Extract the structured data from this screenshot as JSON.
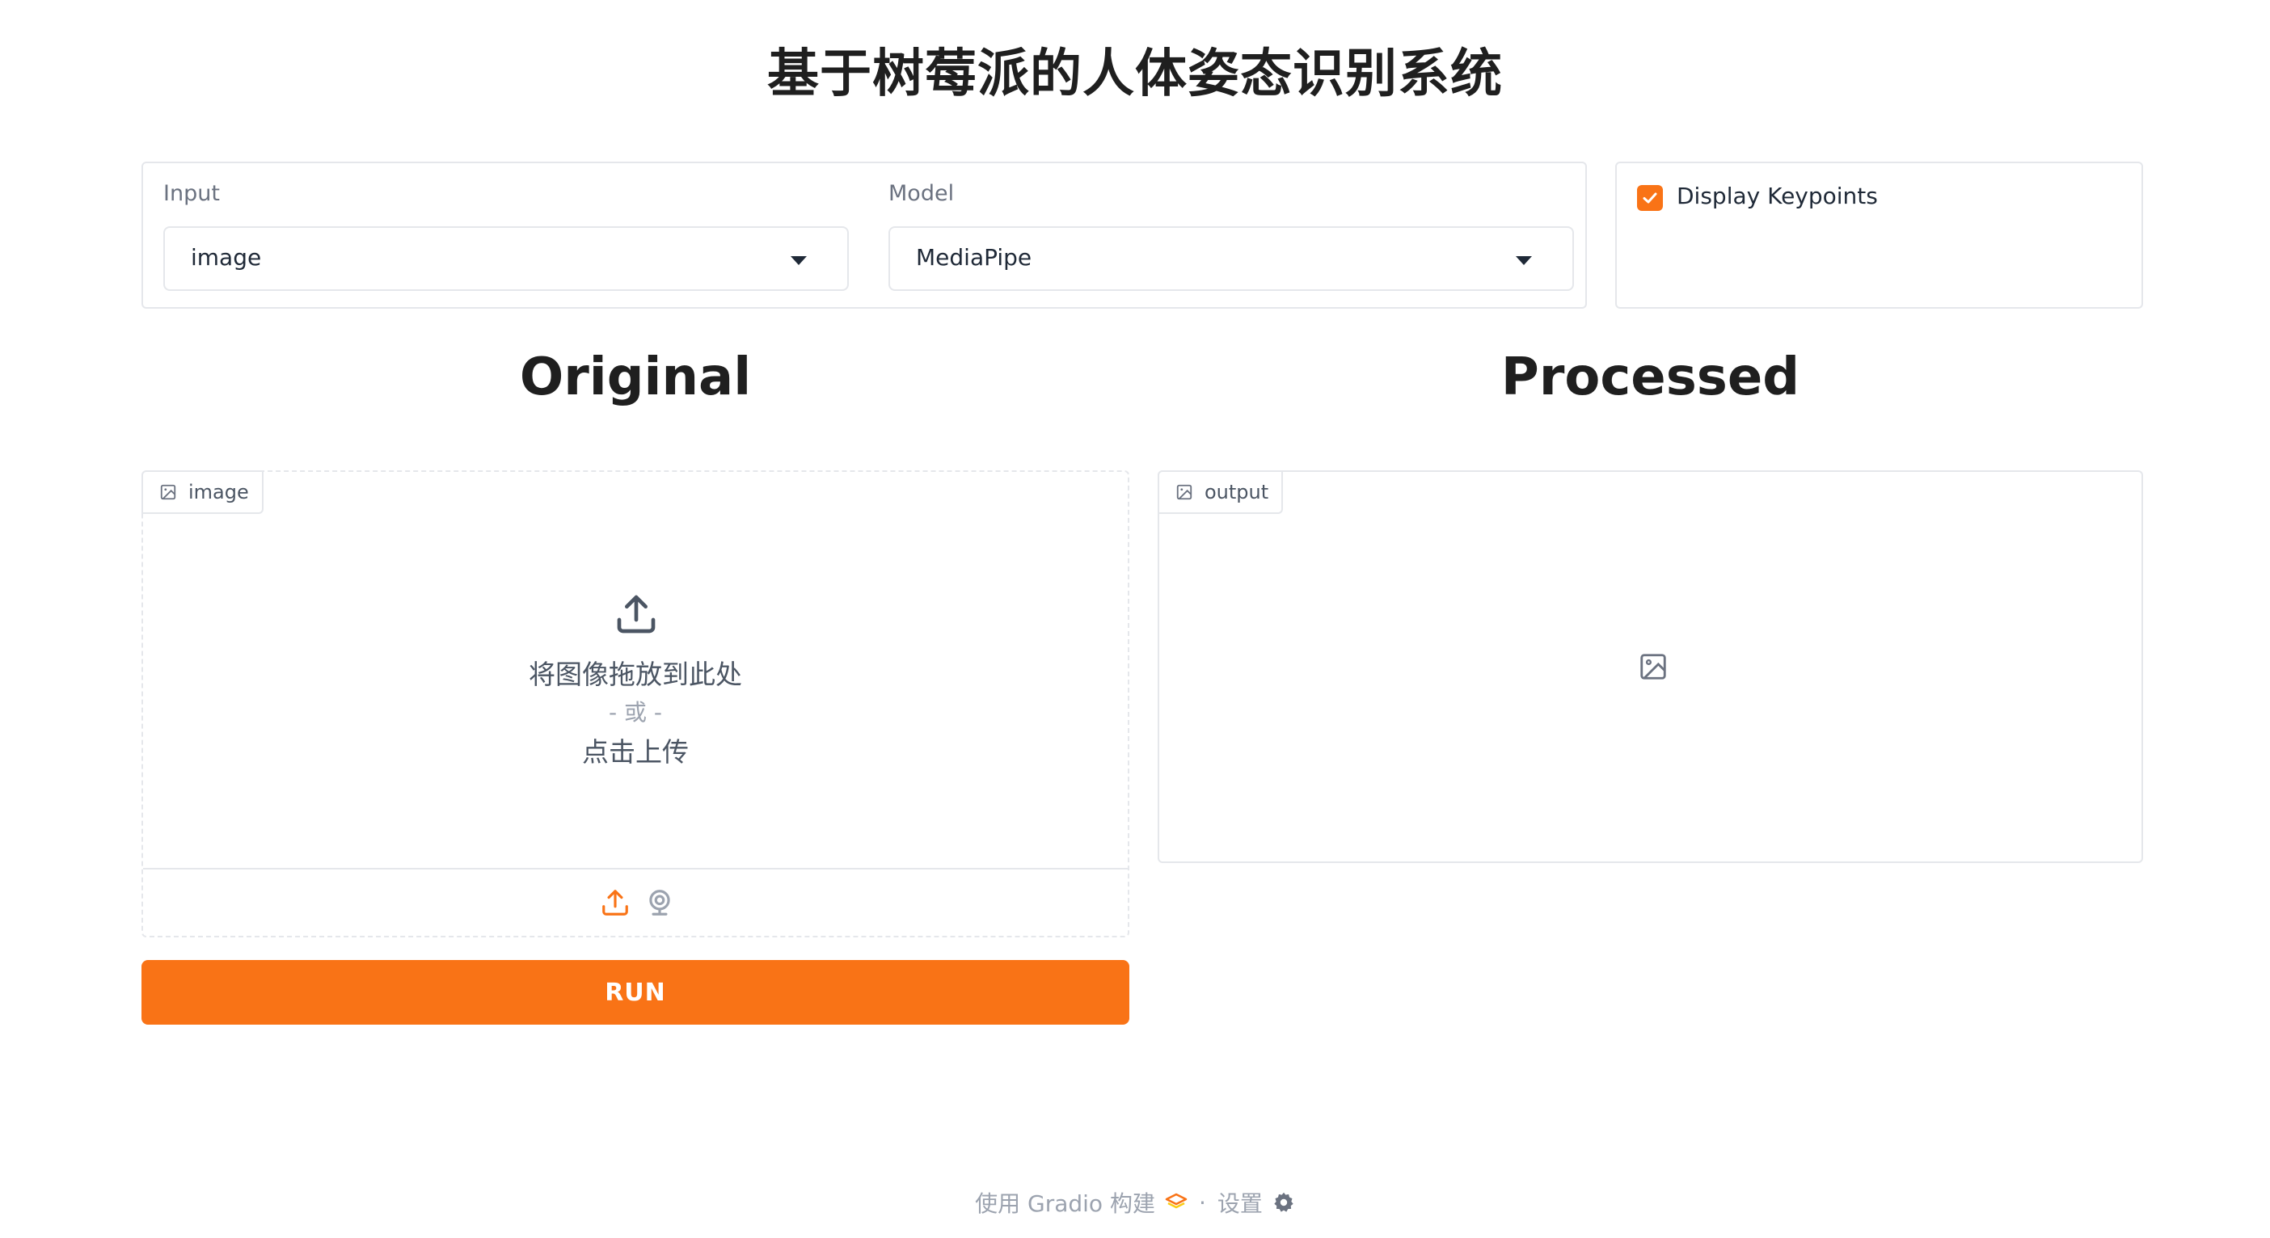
{
  "page": {
    "title": "基于树莓派的人体姿态识别系统"
  },
  "settings": {
    "input": {
      "label": "Input",
      "value": "image"
    },
    "model": {
      "label": "Model",
      "value": "MediaPipe"
    },
    "keypoints": {
      "label": "Display Keypoints",
      "checked": true
    }
  },
  "sections": {
    "original_heading": "Original",
    "processed_heading": "Processed"
  },
  "image_input": {
    "tag_label": "image",
    "drop_text": "将图像拖放到此处",
    "or_text": "- 或 -",
    "click_text": "点击上传",
    "sources": [
      "upload-icon",
      "webcam-icon"
    ]
  },
  "image_output": {
    "tag_label": "output"
  },
  "run_button": {
    "label": "RUN"
  },
  "footer": {
    "built_with": "使用 Gradio 构建",
    "separator": "·",
    "settings": "设置"
  },
  "colors": {
    "accent": "#f97316",
    "border": "#e5e7eb",
    "muted_text": "#9ca3af"
  }
}
